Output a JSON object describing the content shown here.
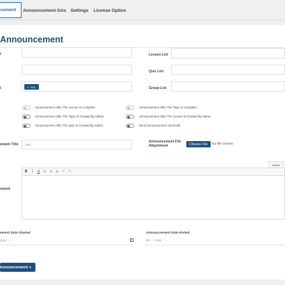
{
  "tabs": [
    {
      "label": "uncement",
      "active": true
    },
    {
      "label": "Announcement lists",
      "active": false
    },
    {
      "label": "Settings",
      "active": false
    },
    {
      "label": "License Option",
      "active": false
    }
  ],
  "page_title": "Announcement",
  "fields": {
    "left_label_1": "t",
    "lesson_list_label": "Lesson List",
    "quiz_list_label": "Quiz List",
    "left_label_3": "t",
    "group_list_label": "Group List",
    "selected_chip": "ALL",
    "chip_remove": "×"
  },
  "toggles": [
    {
      "label": "Announcement After The Lesson Is Complete.",
      "on": false
    },
    {
      "label": "Announcement After The Topic Is Complete.",
      "on": false
    },
    {
      "label": "Announcement After The Topic Is Created By Admin.",
      "on": true
    },
    {
      "label": "Announcement After The Lesson Is Created By Admin.",
      "on": true
    },
    {
      "label": "Announcement After The Quiz Is Created By Admin.",
      "on": true
    },
    {
      "label": "Send Announcement Via Email.",
      "on": true
    }
  ],
  "title_field": {
    "label": "ement Title",
    "placeholder": "Title"
  },
  "attachment": {
    "label_line1": "Announcement File",
    "label_line2": "Attachment",
    "button": "Choose File",
    "status": "No file chosen"
  },
  "editor": {
    "label": "ement",
    "visual_tab": "Visual",
    "toolbar": [
      {
        "name": "bold-icon",
        "glyph": "B"
      },
      {
        "name": "italic-icon",
        "glyph": "I"
      },
      {
        "name": "underline-icon",
        "glyph": "U"
      },
      {
        "name": "align-left-icon",
        "glyph": "≡"
      },
      {
        "name": "align-center-icon",
        "glyph": "≡"
      },
      {
        "name": "align-right-icon",
        "glyph": "≡"
      },
      {
        "name": "undo-icon",
        "glyph": "↶"
      },
      {
        "name": "redo-icon",
        "glyph": "↷"
      }
    ]
  },
  "dates": {
    "start_label": "ement Date Started",
    "start_placeholder": "yyyy  -- --",
    "end_label": "Announcement Date Ended",
    "end_placeholder": "dd ---- yyyy  -- --"
  },
  "submit_label": "Announcement +",
  "colors": {
    "accent": "#2271b1",
    "primary_button": "#1f4f7c",
    "title": "#1d4f6e"
  }
}
